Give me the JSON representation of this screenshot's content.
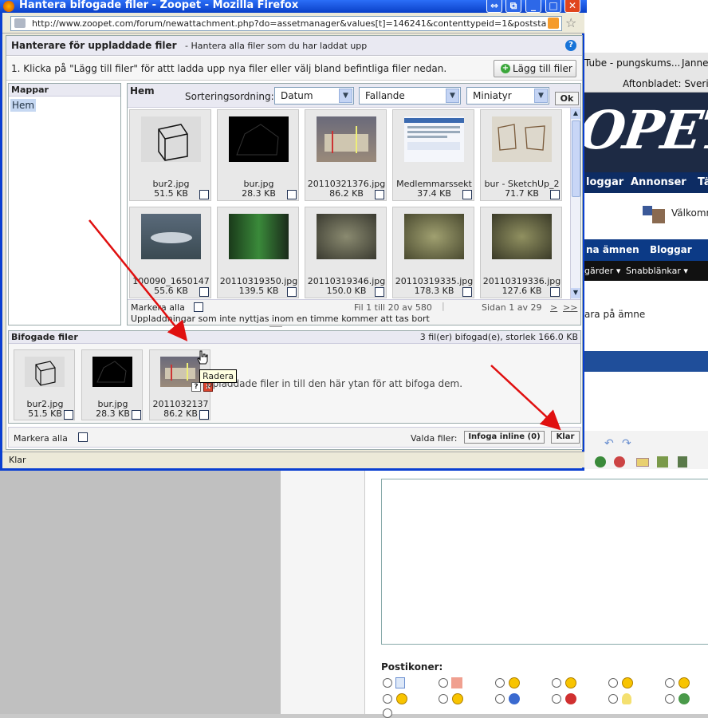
{
  "window": {
    "title": "Hantera bifogade filer - Zoopet - Mozilla Firefox",
    "url": "http://www.zoopet.com/forum/newattachment.php?do=assetmanager&values[t]=146241&contenttypeid=1&poststarttime=130088",
    "status": "Klar"
  },
  "manager": {
    "title": "Hanterare för uppladdade filer",
    "subtitle": "- Hantera alla filer som du har laddat upp",
    "instruction": "1. Klicka på \"Lägg till filer\" för attt ladda upp nya filer eller välj bland befintliga filer nedan.",
    "add_button": "Lägg till filer",
    "help": "?"
  },
  "folders": {
    "header": "Mappar",
    "items": [
      "Hem"
    ]
  },
  "browser": {
    "header": "Hem",
    "sort_label": "Sorteringsordning:",
    "sort_field": "Datum",
    "sort_order": "Fallande",
    "view_mode": "Miniatyr",
    "ok": "Ok",
    "files": [
      {
        "name": "bur2.jpg",
        "size": "51.5 KB"
      },
      {
        "name": "bur.jpg",
        "size": "28.3 KB"
      },
      {
        "name": "20110321376.jpg",
        "size": "86.2 KB"
      },
      {
        "name": "Medlemmarssekt",
        "size": "37.4 KB"
      },
      {
        "name": "bur - SketchUp_2",
        "size": "71.7 KB"
      },
      {
        "name": "100090_1650147",
        "size": "55.6 KB"
      },
      {
        "name": "20110319350.jpg",
        "size": "139.5 KB"
      },
      {
        "name": "20110319346.jpg",
        "size": "150.0 KB"
      },
      {
        "name": "20110319335.jpg",
        "size": "178.3 KB"
      },
      {
        "name": "20110319336.jpg",
        "size": "127.6 KB"
      }
    ],
    "select_all": "Markera alla",
    "file_range": "Fil 1 till 20 av 580",
    "page_info": "Sidan 1 av 29",
    "next": ">",
    "last": ">>",
    "note": "Uppladdningar som inte nyttjas inom en timme kommer att tas bort"
  },
  "attached": {
    "header": "Bifogade filer",
    "summary": "3 fil(er) bifogad(e), storlek 166.0 KB",
    "files": [
      {
        "name": "bur2.jpg",
        "size": "51.5 KB"
      },
      {
        "name": "bur.jpg",
        "size": "28.3 KB"
      },
      {
        "name": "2011032137",
        "size": "86.2 KB"
      }
    ],
    "drop_hint": "ppladdade filer in till den här ytan för att bifoga dem.",
    "help_btn": "?",
    "delete_btn": "x",
    "tooltip": "Radera"
  },
  "bottom": {
    "select_all": "Markera alla",
    "selected_label": "Valda filer:",
    "insert_inline": "Infoga inline (0)",
    "done": "Klar"
  },
  "background": {
    "tab1": "Tube - pungskums...",
    "tab2": "Janne",
    "tab3": "Aftonbladet: Sveriges",
    "banner": "OPET",
    "nav1": [
      "loggar",
      "Annonser",
      "Tä"
    ],
    "welcome": "Välkomm",
    "nav2": [
      "na ämnen",
      "Bloggar"
    ],
    "nav3": [
      "gärder ▾",
      "Snabblänkar ▾"
    ],
    "reply_text": "ara på ämne",
    "post_icons_label": "Postikoner:"
  },
  "colors": {
    "titlebar": "#0a40c8",
    "delete": "#d9442c",
    "arrow": "#e01010",
    "selection": "#c6d8f2"
  }
}
